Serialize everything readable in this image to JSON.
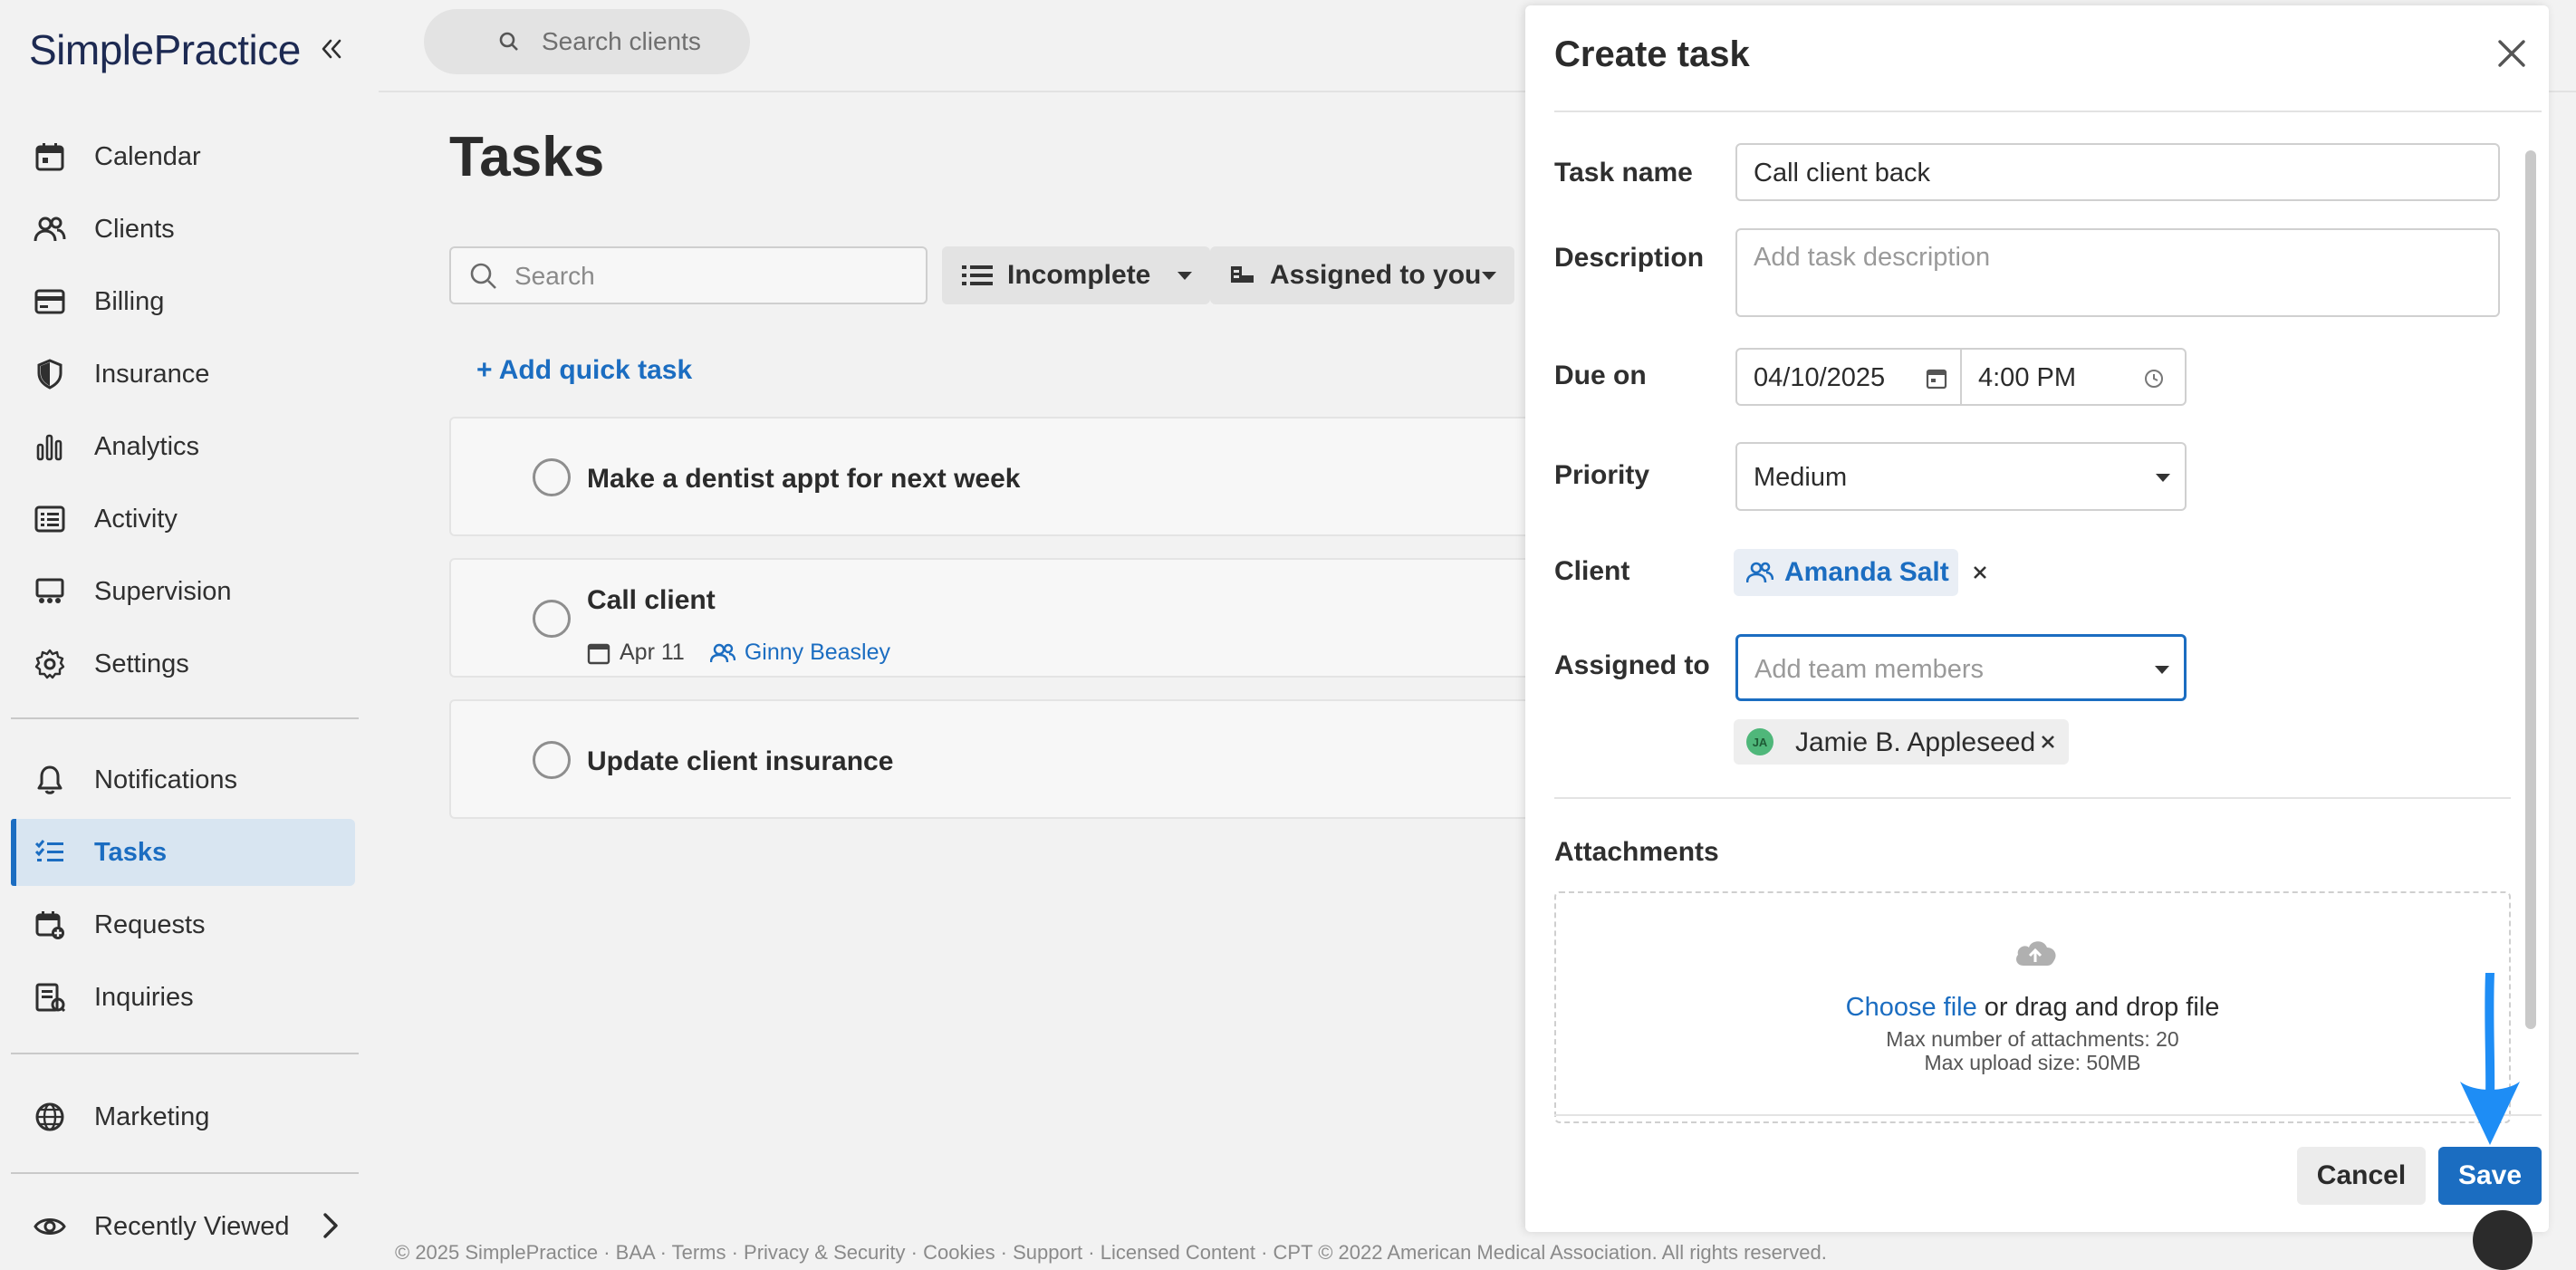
{
  "app": {
    "logo_text": "SimplePractice",
    "brand_color": "#1b6dc1"
  },
  "sidebar": {
    "items": [
      {
        "label": "Calendar",
        "icon": "calendar-icon"
      },
      {
        "label": "Clients",
        "icon": "people-icon"
      },
      {
        "label": "Billing",
        "icon": "credit-card-icon"
      },
      {
        "label": "Insurance",
        "icon": "shield-icon"
      },
      {
        "label": "Analytics",
        "icon": "bar-chart-icon"
      },
      {
        "label": "Activity",
        "icon": "list-icon"
      },
      {
        "label": "Supervision",
        "icon": "supervision-icon"
      },
      {
        "label": "Settings",
        "icon": "gear-icon"
      },
      {
        "label": "Notifications",
        "icon": "bell-icon"
      },
      {
        "label": "Tasks",
        "icon": "tasks-icon",
        "active": true
      },
      {
        "label": "Requests",
        "icon": "calendar-plus-icon"
      },
      {
        "label": "Inquiries",
        "icon": "inquiries-icon"
      },
      {
        "label": "Marketing",
        "icon": "globe-icon"
      },
      {
        "label": "Recently Viewed",
        "icon": "eye-icon"
      }
    ]
  },
  "header": {
    "search_placeholder": "Search clients"
  },
  "tasks_page": {
    "title": "Tasks",
    "search_placeholder": "Search",
    "status_filter": "Incomplete",
    "assignee_filter": "Assigned to you",
    "add_quick_task": "+ Add quick task",
    "tasks": [
      {
        "title": "Make a dentist appt for next week"
      },
      {
        "title": "Call client",
        "due": "Apr 11",
        "client": "Ginny Beasley"
      },
      {
        "title": "Update client insurance"
      }
    ]
  },
  "footer": {
    "text": "© 2025 SimplePractice · BAA · Terms · Privacy & Security · Cookies · Support · Licensed Content · CPT © 2022 American Medical Association. All rights reserved."
  },
  "create_task": {
    "title": "Create task",
    "task_name_label": "Task name",
    "task_name_value": "Call client back",
    "description_label": "Description",
    "description_placeholder": "Add task description",
    "due_on_label": "Due on",
    "due_date": "04/10/2025",
    "due_time": "4:00 PM",
    "priority_label": "Priority",
    "priority_value": "Medium",
    "client_label": "Client",
    "client_value": "Amanda Salt",
    "assigned_to_label": "Assigned to",
    "assigned_placeholder": "Add team members",
    "assigned_member": "Jamie B. Appleseed",
    "assigned_member_initials": "JA",
    "attachments_label": "Attachments",
    "choose_file": "Choose file",
    "drag_drop": " or drag and drop file",
    "max_attachments": "Max number of attachments: 20",
    "max_upload": "Max upload size: 50MB",
    "cancel_label": "Cancel",
    "save_label": "Save"
  }
}
